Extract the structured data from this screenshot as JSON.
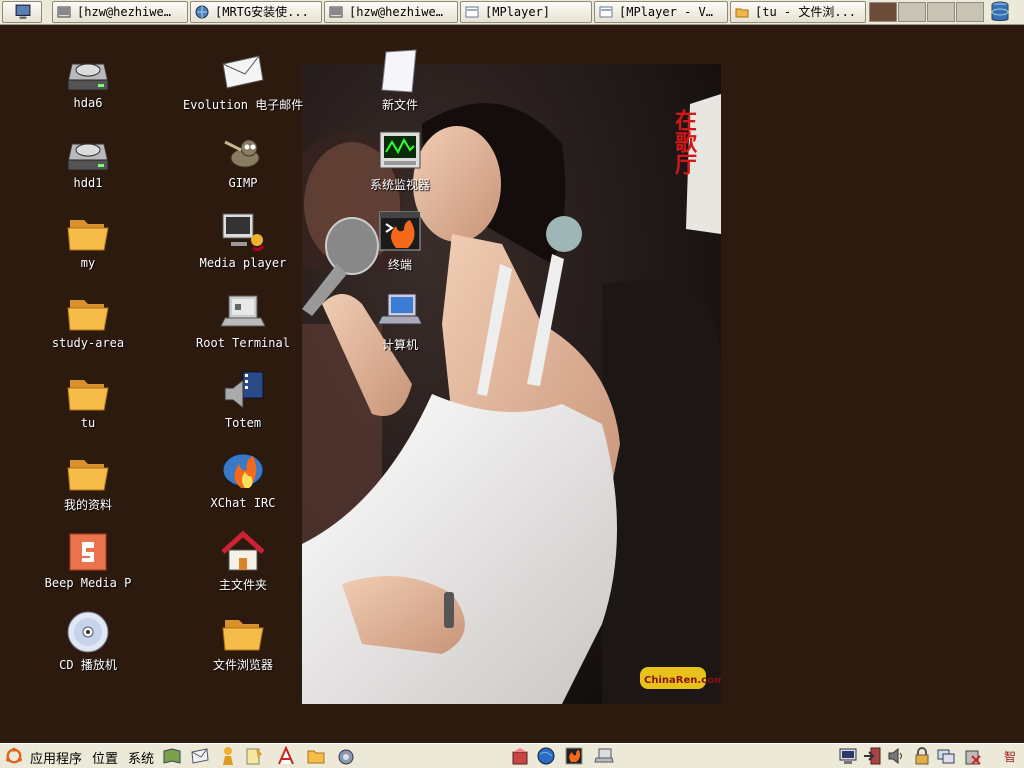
{
  "taskbar": {
    "windows": [
      {
        "label": "[hzw@hezhiwe…",
        "icon": "terminal-icon"
      },
      {
        "label": "[MRTG安装使...",
        "icon": "browser-globe-icon"
      },
      {
        "label": "[hzw@hezhiwe…",
        "icon": "terminal-icon"
      },
      {
        "label": "[MPlayer]",
        "icon": "mplayer-icon"
      },
      {
        "label": "[MPlayer - V…",
        "icon": "mplayer-icon"
      },
      {
        "label": "[tu - 文件浏...",
        "icon": "folder-icon"
      }
    ],
    "workspace_colors": [
      "#6b4c38",
      "#c8c4b4",
      "#c8c4b4",
      "#c8c4b4"
    ]
  },
  "desktop": {
    "col1": [
      "hda6",
      "hdd1",
      "my",
      "study-area",
      "tu",
      "我的资料",
      "Beep Media P",
      "CD 播放机"
    ],
    "col2": [
      "Evolution 电子邮件",
      "GIMP",
      "Media player",
      "Root Terminal",
      "Totem",
      "XChat IRC",
      "主文件夹",
      "文件浏览器"
    ],
    "col3": [
      "新文件",
      "系统监视器",
      "终端",
      "计算机"
    ]
  },
  "wallpaper": {
    "caption": "在歌厅",
    "watermark": "ChinaRen.com"
  },
  "panel": {
    "applications": "应用程序",
    "places": "位置",
    "system": "系统",
    "ime": "智"
  },
  "colors": {
    "desktop_bg": "#2c1a0e",
    "panel_bg": "#ece9d8"
  }
}
